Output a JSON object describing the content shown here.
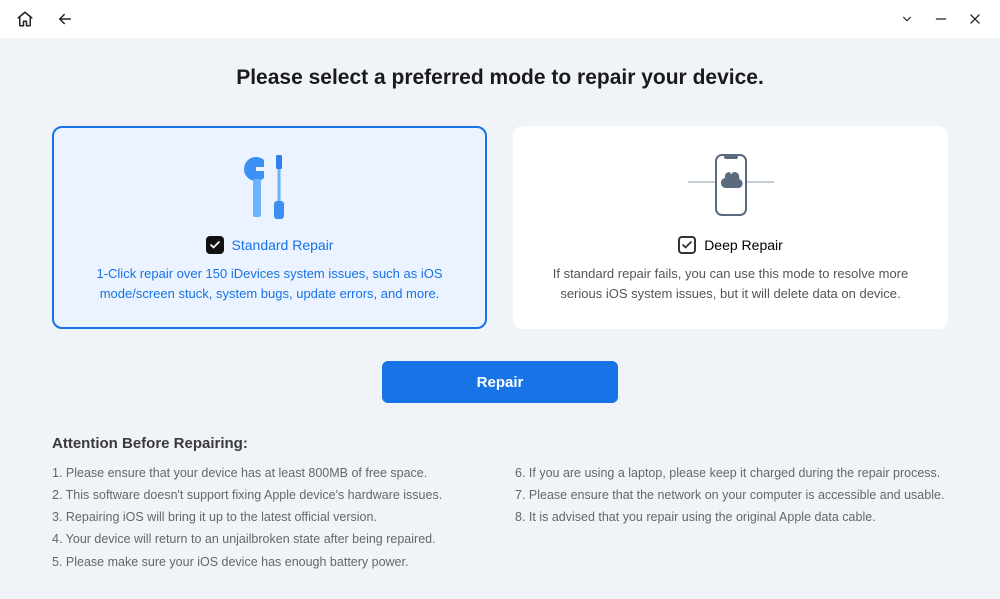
{
  "page_title": "Please select a preferred mode to repair your device.",
  "cards": {
    "standard": {
      "label": "Standard Repair",
      "desc": "1-Click repair over 150 iDevices system issues, such as iOS mode/screen stuck, system bugs, update errors, and more.",
      "selected": true
    },
    "deep": {
      "label": "Deep Repair",
      "desc": "If standard repair fails, you can use this mode to resolve more serious iOS system issues, but it will delete data on device.",
      "selected": false
    }
  },
  "repair_button": "Repair",
  "attention": {
    "title": "Attention Before Repairing:",
    "left": [
      "1. Please ensure that your device has at least 800MB of free space.",
      "2. This software doesn't support fixing Apple device's hardware issues.",
      "3. Repairing iOS will bring it up to the latest official version.",
      "4. Your device will return to an unjailbroken state after being repaired.",
      "5. Please make sure your iOS device has enough battery power."
    ],
    "right": [
      "6. If you are using a laptop, please keep it charged during the repair process.",
      "7. Please ensure that the network on your computer is accessible and usable.",
      "8. It is advised that you repair using the original Apple data cable."
    ]
  },
  "colors": {
    "accent": "#1773e6"
  }
}
